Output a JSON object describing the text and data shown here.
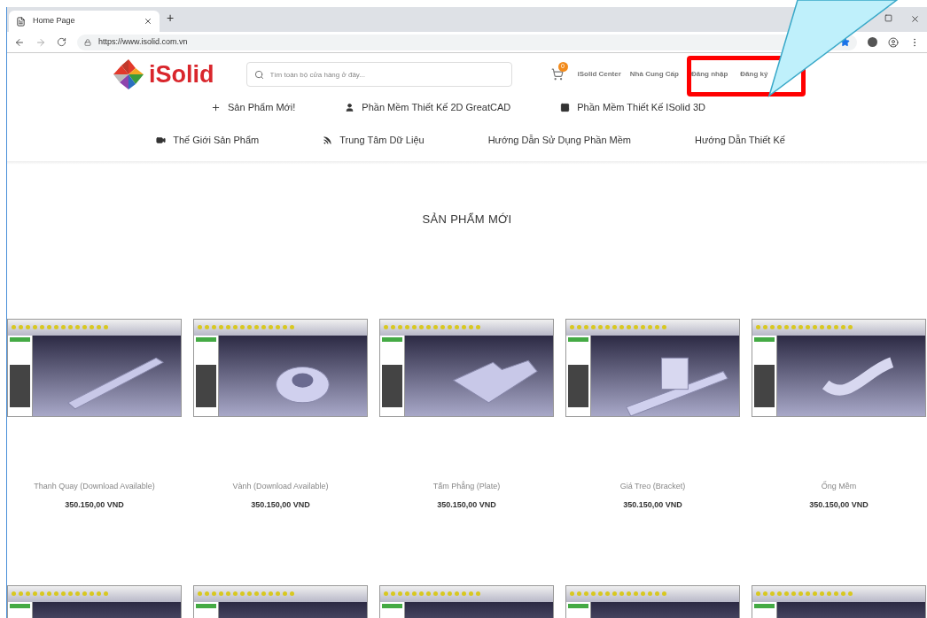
{
  "browser": {
    "tab_title": "Home Page",
    "new_tab": "+",
    "url": "https://www.isolid.com.vn"
  },
  "header": {
    "logo_text": "iSolid",
    "search_placeholder": "Tìm toàn bộ cửa hàng ở đây...",
    "cart_count": "0",
    "links": [
      "iSolid Center",
      "Nhà Cung Cấp"
    ],
    "auth_links": [
      "Đăng nhập",
      "Đăng ký"
    ]
  },
  "nav_rows": [
    [
      {
        "kind": "plus",
        "label": "Sản Phẩm Mới!"
      },
      {
        "kind": "user",
        "label": "Phần Mềm Thiết Kế 2D GreatCAD"
      },
      {
        "kind": "image",
        "label": "Phần Mềm Thiết Kế ISolid 3D"
      }
    ],
    [
      {
        "kind": "video",
        "label": "Thế Giới Sản Phẩm"
      },
      {
        "kind": "rss",
        "label": "Trung Tâm Dữ Liệu"
      },
      {
        "kind": "text",
        "label": "Hướng Dẫn Sử Dụng Phần Mềm"
      },
      {
        "kind": "text",
        "label": "Hướng Dẫn Thiết Kế"
      }
    ]
  ],
  "section_title": "SẢN PHẨM MỚI",
  "products": [
    {
      "kind": "bar",
      "title": "Thanh Quay (Download Available)",
      "price": "350.150,00 VND"
    },
    {
      "kind": "ring",
      "title": "Vành (Download Available)",
      "price": "350.150,00 VND"
    },
    {
      "kind": "plate",
      "title": "Tấm Phẳng (Plate)",
      "price": "350.150,00 VND"
    },
    {
      "kind": "bracket",
      "title": "Giá Treo (Bracket)",
      "price": "350.150,00 VND"
    },
    {
      "kind": "pipe",
      "title": "Ống Mềm",
      "price": "350.150,00 VND"
    }
  ],
  "products_row_2": [
    {
      "kind": "thumbnail"
    },
    {
      "kind": "thumbnail"
    },
    {
      "kind": "thumbnail"
    },
    {
      "kind": "thumbnail"
    },
    {
      "kind": "thumbnail"
    }
  ],
  "annotation": {
    "highlight_auth": true,
    "callout": true
  }
}
